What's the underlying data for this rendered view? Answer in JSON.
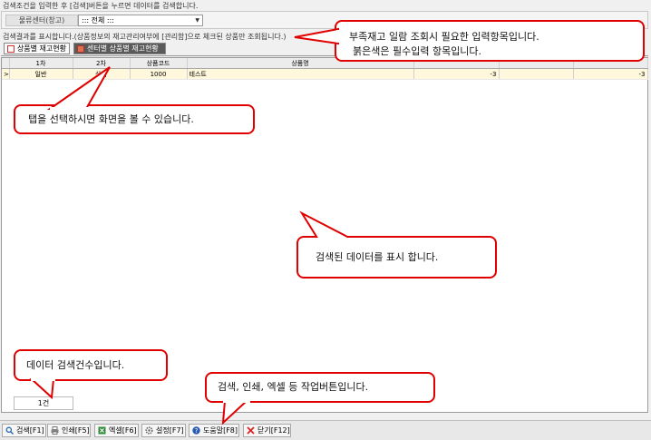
{
  "top_hint": "검색조건을 입력한 후 [검색]버튼을 누르면 데이터를 검색합니다.",
  "filter": {
    "label": "물류센터(창고)",
    "select_value": "::: 전체 :::"
  },
  "result_hint": "검색결과를 표시합니다.(상품정보의 재고관리여부에 [관리함]으로 체크된 상품만 조회됩니다.)",
  "tabs": [
    {
      "label": "상품별 재고현황"
    },
    {
      "label": "센터별 상품별 재고현황"
    }
  ],
  "grid": {
    "columns": [
      "",
      "1차",
      "2차",
      "상품코드",
      "상품명",
      "",
      "",
      ""
    ],
    "rows": [
      {
        "marker": ">",
        "cat1": "일반",
        "cat2": "상품",
        "code": "1000",
        "name": "테스트",
        "v1": "-3",
        "v2": "",
        "v3": "-3"
      }
    ]
  },
  "count": "1건",
  "toolbar": [
    {
      "label": "검색[F1]",
      "icon": "search-icon"
    },
    {
      "label": "인쇄[F5]",
      "icon": "printer-icon"
    },
    {
      "label": "엑셀[F6]",
      "icon": "excel-icon"
    },
    {
      "label": "설정[F7]",
      "icon": "gear-icon"
    },
    {
      "label": "도움말[F8]",
      "icon": "help-icon"
    },
    {
      "label": "닫기[F12]",
      "icon": "close-icon"
    }
  ],
  "callouts": {
    "required_fields": [
      "부족재고 일람 조회시 필요한 입력항목입니다.",
      "붉은색은 필수입력 항목입니다."
    ],
    "tabs": "탭을 선택하시면 화면을 볼 수 있습니다.",
    "data": "검색된 데이터를 표시 합니다.",
    "count": "데이터 검색건수입니다.",
    "buttons": "검색, 인쇄, 엑셀 등 작업버튼입니다."
  }
}
